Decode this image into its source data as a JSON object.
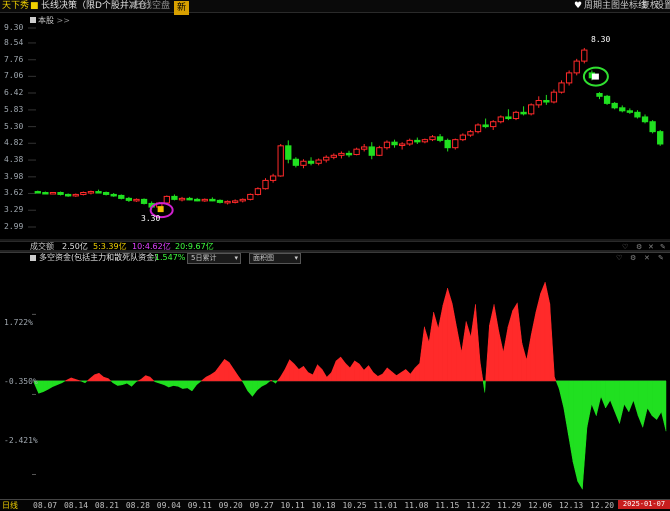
{
  "topbar": {
    "app_title": "天下秀",
    "indicator_name": "长线决策（限D个股并减仓）",
    "line_type": "日线空盘",
    "badge": "新",
    "right_items": [
      "周期",
      "主图",
      "坐标线",
      "复权",
      "设置"
    ]
  },
  "main_panel": {
    "toggle_label": "本股",
    "toggle_icon": ">>",
    "high_label": "8.30",
    "low_label": "3.30",
    "y_ticks": [
      "9.30",
      "8.54",
      "7.76",
      "7.06",
      "6.42",
      "5.83",
      "5.30",
      "4.82",
      "4.38",
      "3.98",
      "3.62",
      "3.29",
      "2.99"
    ]
  },
  "volume_bar": {
    "label": "成交额",
    "value": "2.50亿",
    "ma5": "5:3.39亿",
    "ma10": "10:4.62亿",
    "ma20": "20:9.67亿"
  },
  "flow_panel": {
    "title": "多空资金(包括主力和散死队资金)",
    "value": "-1.547%",
    "period_select": "5日累计",
    "style_select": "面积图",
    "y_ticks": [
      "1.722%",
      "-0.350%",
      "-2.421%"
    ]
  },
  "x_axis": {
    "left_label": "日线",
    "ticks": [
      "08.07",
      "08.14",
      "08.21",
      "08.28",
      "09.04",
      "09.11",
      "09.20",
      "09.27",
      "10.11",
      "10.18",
      "10.25",
      "11.01",
      "11.08",
      "11.15",
      "11.22",
      "11.29",
      "12.06",
      "12.13",
      "12.20"
    ],
    "current_date": "2025-01-07"
  },
  "colors": {
    "up": "#ff2a2a",
    "down": "#20e020",
    "accent": "#f0d000",
    "bg": "#000000"
  },
  "chart_data": [
    {
      "type": "candlestick",
      "title": "",
      "ylim": [
        2.99,
        9.3
      ],
      "y_scale": "log",
      "candles": [
        [
          3.66,
          3.68,
          3.62,
          3.64
        ],
        [
          3.64,
          3.66,
          3.6,
          3.63
        ],
        [
          3.63,
          3.65,
          3.6,
          3.64
        ],
        [
          3.64,
          3.66,
          3.58,
          3.6
        ],
        [
          3.6,
          3.62,
          3.55,
          3.57
        ],
        [
          3.57,
          3.62,
          3.55,
          3.6
        ],
        [
          3.6,
          3.66,
          3.58,
          3.64
        ],
        [
          3.64,
          3.68,
          3.6,
          3.66
        ],
        [
          3.66,
          3.7,
          3.62,
          3.64
        ],
        [
          3.64,
          3.66,
          3.58,
          3.6
        ],
        [
          3.6,
          3.63,
          3.55,
          3.58
        ],
        [
          3.58,
          3.6,
          3.5,
          3.52
        ],
        [
          3.52,
          3.55,
          3.45,
          3.48
        ],
        [
          3.48,
          3.52,
          3.45,
          3.5
        ],
        [
          3.5,
          3.52,
          3.4,
          3.42
        ],
        [
          3.42,
          3.46,
          3.3,
          3.35
        ],
        [
          3.35,
          3.45,
          3.3,
          3.43
        ],
        [
          3.43,
          3.58,
          3.4,
          3.56
        ],
        [
          3.56,
          3.6,
          3.48,
          3.5
        ],
        [
          3.5,
          3.55,
          3.46,
          3.52
        ],
        [
          3.52,
          3.55,
          3.48,
          3.5
        ],
        [
          3.5,
          3.53,
          3.46,
          3.48
        ],
        [
          3.48,
          3.52,
          3.45,
          3.5
        ],
        [
          3.5,
          3.54,
          3.46,
          3.48
        ],
        [
          3.48,
          3.5,
          3.42,
          3.44
        ],
        [
          3.44,
          3.48,
          3.4,
          3.46
        ],
        [
          3.46,
          3.5,
          3.42,
          3.47
        ],
        [
          3.47,
          3.52,
          3.44,
          3.5
        ],
        [
          3.5,
          3.62,
          3.48,
          3.6
        ],
        [
          3.6,
          3.75,
          3.58,
          3.72
        ],
        [
          3.72,
          3.95,
          3.7,
          3.9
        ],
        [
          3.9,
          4.05,
          3.85,
          4.0
        ],
        [
          4.0,
          4.8,
          3.98,
          4.75
        ],
        [
          4.75,
          4.9,
          4.3,
          4.4
        ],
        [
          4.4,
          4.45,
          4.2,
          4.25
        ],
        [
          4.25,
          4.4,
          4.18,
          4.35
        ],
        [
          4.35,
          4.45,
          4.25,
          4.3
        ],
        [
          4.3,
          4.42,
          4.25,
          4.38
        ],
        [
          4.38,
          4.5,
          4.32,
          4.45
        ],
        [
          4.45,
          4.55,
          4.4,
          4.5
        ],
        [
          4.5,
          4.6,
          4.42,
          4.55
        ],
        [
          4.55,
          4.62,
          4.45,
          4.52
        ],
        [
          4.52,
          4.7,
          4.5,
          4.66
        ],
        [
          4.66,
          4.8,
          4.6,
          4.72
        ],
        [
          4.72,
          4.85,
          4.4,
          4.5
        ],
        [
          4.5,
          4.75,
          4.48,
          4.7
        ],
        [
          4.7,
          4.9,
          4.65,
          4.85
        ],
        [
          4.85,
          4.92,
          4.7,
          4.78
        ],
        [
          4.78,
          4.85,
          4.65,
          4.8
        ],
        [
          4.8,
          4.95,
          4.75,
          4.9
        ],
        [
          4.9,
          4.98,
          4.8,
          4.86
        ],
        [
          4.86,
          4.95,
          4.82,
          4.92
        ],
        [
          4.92,
          5.05,
          4.88,
          5.0
        ],
        [
          5.0,
          5.08,
          4.85,
          4.9
        ],
        [
          4.9,
          4.95,
          4.6,
          4.7
        ],
        [
          4.7,
          4.95,
          4.65,
          4.92
        ],
        [
          4.92,
          5.1,
          4.88,
          5.05
        ],
        [
          5.05,
          5.2,
          5.0,
          5.15
        ],
        [
          5.15,
          5.4,
          5.1,
          5.35
        ],
        [
          5.35,
          5.55,
          5.25,
          5.3
        ],
        [
          5.3,
          5.5,
          5.2,
          5.45
        ],
        [
          5.45,
          5.65,
          5.4,
          5.6
        ],
        [
          5.6,
          5.85,
          5.5,
          5.55
        ],
        [
          5.55,
          5.8,
          5.5,
          5.75
        ],
        [
          5.75,
          5.95,
          5.65,
          5.7
        ],
        [
          5.7,
          6.05,
          5.65,
          6.0
        ],
        [
          6.0,
          6.3,
          5.9,
          6.15
        ],
        [
          6.15,
          6.35,
          6.0,
          6.1
        ],
        [
          6.1,
          6.55,
          6.05,
          6.45
        ],
        [
          6.45,
          6.9,
          6.4,
          6.8
        ],
        [
          6.8,
          7.3,
          6.7,
          7.2
        ],
        [
          7.2,
          7.8,
          7.1,
          7.7
        ],
        [
          7.7,
          8.3,
          7.6,
          8.2
        ],
        [
          7.2,
          7.3,
          6.9,
          7.0
        ],
        [
          6.4,
          6.45,
          6.2,
          6.3
        ],
        [
          6.3,
          6.35,
          6.0,
          6.05
        ],
        [
          6.05,
          6.1,
          5.85,
          5.9
        ],
        [
          5.9,
          5.98,
          5.75,
          5.8
        ],
        [
          5.8,
          5.88,
          5.7,
          5.75
        ],
        [
          5.75,
          5.82,
          5.55,
          5.6
        ],
        [
          5.6,
          5.68,
          5.4,
          5.45
        ],
        [
          5.45,
          5.5,
          5.1,
          5.15
        ],
        [
          5.15,
          5.2,
          4.75,
          4.8
        ]
      ]
    },
    {
      "type": "area",
      "title": "多空资金",
      "ylim": [
        -2.421,
        1.722
      ],
      "values": [
        -0.05,
        -0.32,
        -0.28,
        -0.22,
        -0.15,
        -0.1,
        -0.05,
        0.02,
        0.08,
        0.04,
        0.0,
        -0.05,
        0.06,
        0.16,
        0.2,
        0.1,
        0.06,
        -0.05,
        -0.12,
        -0.1,
        -0.06,
        -0.14,
        -0.02,
        0.04,
        0.14,
        0.1,
        -0.02,
        -0.06,
        -0.1,
        -0.16,
        -0.12,
        -0.14,
        -0.2,
        -0.18,
        -0.26,
        -0.1,
        0.0,
        0.1,
        0.16,
        0.24,
        0.4,
        0.56,
        0.48,
        0.3,
        0.12,
        -0.04,
        -0.26,
        -0.4,
        -0.24,
        -0.14,
        -0.08,
        0.02,
        -0.06,
        0.1,
        0.3,
        0.55,
        0.44,
        0.3,
        0.38,
        0.22,
        0.16,
        0.42,
        0.3,
        0.1,
        0.22,
        0.52,
        0.62,
        0.46,
        0.34,
        0.52,
        0.44,
        0.28,
        0.4,
        0.22,
        0.12,
        0.18,
        0.34,
        0.24,
        0.14,
        0.22,
        0.3,
        0.18,
        0.34,
        0.46,
        1.4,
        1.0,
        1.78,
        1.36,
        1.96,
        2.4,
        2.0,
        1.36,
        0.74,
        1.54,
        1.14,
        1.98,
        0.5,
        -0.3,
        1.44,
        1.98,
        1.3,
        0.74,
        1.4,
        1.82,
        2.02,
        0.98,
        0.54,
        1.2,
        1.78,
        2.26,
        2.56,
        2.0,
        0.1,
        -0.2,
        -0.7,
        -1.4,
        -2.1,
        -2.6,
        -2.8,
        -1.2,
        -0.6,
        -0.9,
        -0.4,
        -0.7,
        -0.5,
        -0.8,
        -1.1,
        -0.6,
        -0.8,
        -0.5,
        -0.9,
        -1.2,
        -0.7,
        -0.9,
        -1.0,
        -0.8,
        -1.3
      ]
    }
  ]
}
